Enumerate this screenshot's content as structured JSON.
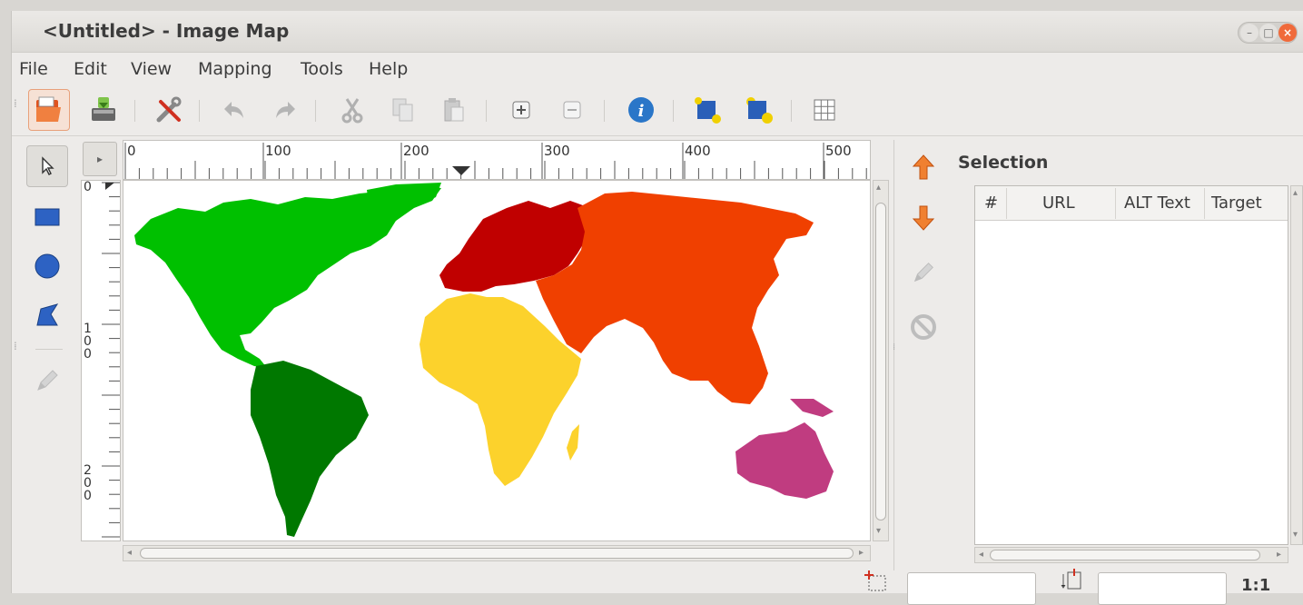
{
  "window": {
    "title": "<Untitled> - Image Map",
    "controls": {
      "minimize": "–",
      "maximize": "□",
      "close": "×"
    }
  },
  "menu": [
    "File",
    "Edit",
    "View",
    "Mapping",
    "Tools",
    "Help"
  ],
  "toolbar": {
    "buttons": [
      "open-icon",
      "save-icon",
      "preferences-icon",
      "undo-icon",
      "redo-icon",
      "cut-icon",
      "copy-icon",
      "paste-icon",
      "zoom-in-icon",
      "zoom-out-icon",
      "info-icon",
      "send-to-back-icon",
      "bring-to-front-icon",
      "grid-icon"
    ]
  },
  "left_tools": [
    "arrow-select-icon",
    "rectangle-icon",
    "circle-icon",
    "polygon-icon",
    "edit-pencil-icon"
  ],
  "ruler": {
    "horizontal_labels": [
      "0",
      "100",
      "200",
      "300",
      "400",
      "500"
    ],
    "vertical_labels": [
      "0",
      "100",
      "200"
    ],
    "corner_arrow": "▸"
  },
  "map": {
    "colors": {
      "north_america": "#00c000",
      "south_america": "#007800",
      "europe": "#c00000",
      "asia": "#f04000",
      "africa": "#fcd22c",
      "oceania": "#c03c80"
    }
  },
  "selection": {
    "title": "Selection",
    "columns": [
      "#",
      "URL",
      "ALT Text",
      "Target"
    ],
    "rows": []
  },
  "right_tools": [
    "move-up-icon",
    "move-down-icon",
    "edit-icon",
    "delete-icon"
  ],
  "scroll": {
    "h_mark": "⁞",
    "left_arrow": "◂",
    "right_arrow": "▸",
    "up_arrow": "▴",
    "down_arrow": "▾"
  },
  "status": {
    "zoom": "1:1",
    "field1": "",
    "field2": ""
  }
}
